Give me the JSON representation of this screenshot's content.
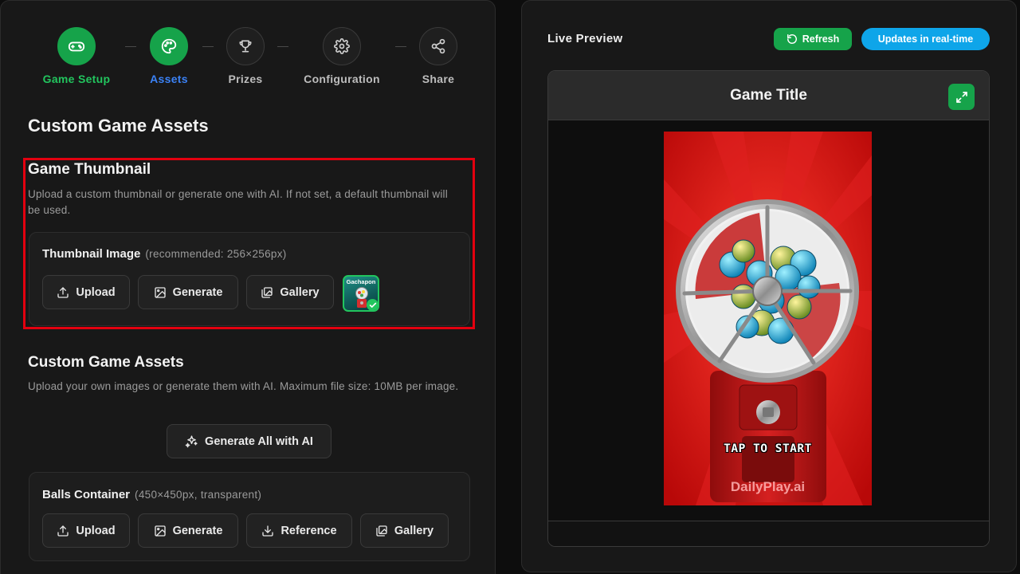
{
  "stepper": {
    "steps": [
      {
        "label": "Game Setup",
        "icon": "gamepad-icon",
        "state": "complete"
      },
      {
        "label": "Assets",
        "icon": "palette-icon",
        "state": "current"
      },
      {
        "label": "Prizes",
        "icon": "trophy-icon",
        "state": "upcoming"
      },
      {
        "label": "Configuration",
        "icon": "gear-icon",
        "state": "upcoming"
      },
      {
        "label": "Share",
        "icon": "share-icon",
        "state": "upcoming"
      }
    ]
  },
  "assets": {
    "heading": "Custom Game Assets",
    "thumbnail": {
      "title": "Game Thumbnail",
      "description": "Upload a custom thumbnail or generate one with AI. If not set, a default thumbnail will be used.",
      "card_label": "Thumbnail Image",
      "card_hint": "(recommended: 256×256px)",
      "buttons": {
        "upload": "Upload",
        "generate": "Generate",
        "gallery": "Gallery"
      },
      "preview_text": "Gachapon",
      "preview_selected": true
    },
    "custom": {
      "title": "Custom Game Assets",
      "description": "Upload your own images or generate them with AI. Maximum file size: 10MB per image.",
      "generate_all": "Generate All with AI",
      "balls_container": {
        "label": "Balls Container",
        "hint": "(450×450px, transparent)",
        "buttons": {
          "upload": "Upload",
          "generate": "Generate",
          "reference": "Reference",
          "gallery": "Gallery"
        }
      }
    }
  },
  "preview": {
    "title": "Live Preview",
    "refresh": "Refresh",
    "realtime": "Updates in real-time",
    "game_title": "Game Title",
    "tap_to_start": "TAP TO START",
    "brand": "DailyPlay.ai"
  },
  "colors": {
    "accent_green": "#16a34a",
    "accent_blue": "#0ea5e9",
    "highlight_red": "#e3000f",
    "game_bg_red": "#d70f0f"
  }
}
